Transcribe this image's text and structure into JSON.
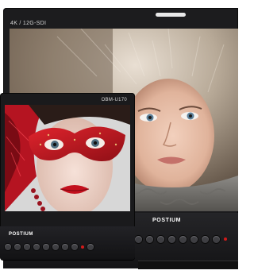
{
  "large_monitor": {
    "label": "4K / 12G-SDI",
    "brand": "POSTIUM",
    "screen_subject": "woman-fur-hood",
    "colors": {
      "bezel": "#1c1c1e",
      "indicator": "#d21a1a"
    }
  },
  "small_monitor": {
    "label": "OBM-U170",
    "brand": "POSTIUM",
    "screen_subject": "woman-red-mask",
    "colors": {
      "bezel": "#1a1a1c",
      "indicator": "#d21a1a"
    }
  }
}
